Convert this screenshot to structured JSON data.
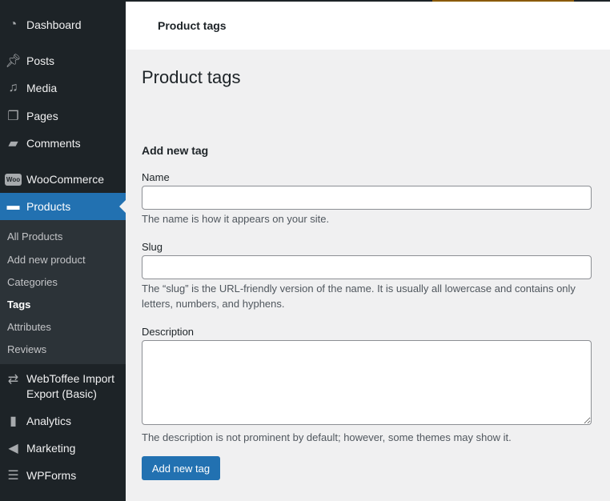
{
  "sidebar": {
    "items": [
      {
        "label": "Dashboard",
        "icon": "dashboard-icon"
      },
      {
        "label": "Posts",
        "icon": "pin-icon"
      },
      {
        "label": "Media",
        "icon": "media-icon"
      },
      {
        "label": "Pages",
        "icon": "pages-icon"
      },
      {
        "label": "Comments",
        "icon": "comment-icon"
      },
      {
        "label": "WooCommerce",
        "icon": "woo-icon"
      },
      {
        "label": "Products",
        "icon": "archive-icon"
      },
      {
        "label": "WebToffee Import Export (Basic)",
        "icon": "arrows-icon"
      },
      {
        "label": "Analytics",
        "icon": "bar-chart-icon"
      },
      {
        "label": "Marketing",
        "icon": "megaphone-icon"
      },
      {
        "label": "WPForms",
        "icon": "form-icon"
      }
    ],
    "submenu": [
      "All Products",
      "Add new product",
      "Categories",
      "Tags",
      "Attributes",
      "Reviews"
    ]
  },
  "header": {
    "title": "Product tags"
  },
  "page": {
    "title": "Product tags",
    "form_title": "Add new tag",
    "name_label": "Name",
    "name_help": "The name is how it appears on your site.",
    "name_value": "",
    "slug_label": "Slug",
    "slug_help": "The “slug” is the URL-friendly version of the name. It is usually all lowercase and contains only letters, numbers, and hyphens.",
    "slug_value": "",
    "desc_label": "Description",
    "desc_help": "The description is not prominent by default; however, some themes may show it.",
    "desc_value": "",
    "submit": "Add new tag"
  },
  "colors": {
    "accent": "#2271b1",
    "sidebar": "#1d2327"
  }
}
